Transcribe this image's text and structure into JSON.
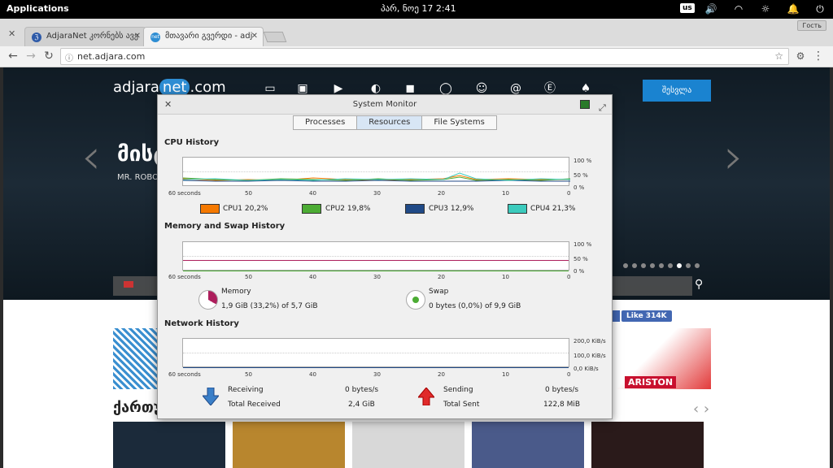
{
  "system_bar": {
    "applications": "Applications",
    "clock": "პარ, ნოე 17   2:41",
    "keyboard_layout": "us"
  },
  "browser": {
    "tabs": [
      {
        "title": "AdjaraNet კორნებს ავე",
        "favicon": "ℨ",
        "active": false
      },
      {
        "title": "მთავარი გვერდი - adj",
        "favicon": "net",
        "active": true
      }
    ],
    "guest_label": "Гость",
    "url": "net.adjara.com"
  },
  "site": {
    "logo_prefix": "adjara",
    "logo_net": "net",
    "logo_suffix": ".com",
    "register_label": "შესვლა",
    "hero_title": "მისტ",
    "hero_subtitle": "MR. ROBOT",
    "like_label": "Like 314K",
    "ariston_label": "ARISTON",
    "section_title": "ქართუ"
  },
  "system_monitor": {
    "title": "System Monitor",
    "tabs": [
      "Processes",
      "Resources",
      "File Systems"
    ],
    "active_tab": "Resources",
    "cpu": {
      "heading": "CPU History",
      "y_labels": [
        "100 %",
        "50 %",
        "0 %"
      ],
      "x_labels": [
        "60 seconds",
        "50",
        "40",
        "30",
        "20",
        "10",
        "0"
      ],
      "legend": [
        {
          "label": "CPU1  20,2%",
          "color": "#f57900"
        },
        {
          "label": "CPU2  19,8%",
          "color": "#4cac34"
        },
        {
          "label": "CPU3  12,9%",
          "color": "#204a87"
        },
        {
          "label": "CPU4  21,3%",
          "color": "#3ccbbd"
        }
      ]
    },
    "memory": {
      "heading": "Memory and Swap History",
      "y_labels": [
        "100 %",
        "50 %",
        "0 %"
      ],
      "x_labels": [
        "60 seconds",
        "50",
        "40",
        "30",
        "20",
        "10",
        "0"
      ],
      "memory_label": "Memory",
      "memory_value": "1,9 GiB (33,2%) of 5,7 GiB",
      "memory_percent": 33.2,
      "memory_color": "#ad1e5c",
      "swap_label": "Swap",
      "swap_value": "0 bytes (0,0%) of 9,9 GiB",
      "swap_percent": 0,
      "swap_color": "#4cac34"
    },
    "network": {
      "heading": "Network History",
      "y_labels": [
        "200,0 KiB/s",
        "100,0 KiB/s",
        "0,0 KiB/s"
      ],
      "x_labels": [
        "60 seconds",
        "50",
        "40",
        "30",
        "20",
        "10",
        "0"
      ],
      "receiving_label": "Receiving",
      "receiving_value": "0 bytes/s",
      "total_received_label": "Total Received",
      "total_received_value": "2,4 GiB",
      "sending_label": "Sending",
      "sending_value": "0 bytes/s",
      "total_sent_label": "Total Sent",
      "total_sent_value": "122,8 MiB"
    }
  }
}
